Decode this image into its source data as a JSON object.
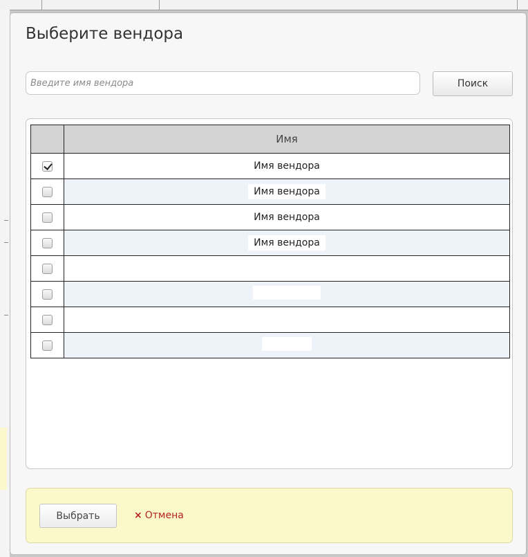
{
  "dialog": {
    "title": "Выберите вендора",
    "search": {
      "placeholder": "Введите имя вендора",
      "value": "",
      "button_label": "Поиск"
    },
    "table": {
      "header_name": "Имя",
      "rows": [
        {
          "checked": true,
          "name": "Имя вендора"
        },
        {
          "checked": false,
          "name": "Имя вендора"
        },
        {
          "checked": false,
          "name": "Имя вендора"
        },
        {
          "checked": false,
          "name": "Имя вендора"
        },
        {
          "checked": false,
          "name": ""
        },
        {
          "checked": false,
          "name": ""
        },
        {
          "checked": false,
          "name": ""
        },
        {
          "checked": false,
          "name": ""
        }
      ]
    },
    "footer": {
      "select_label": "Выбрать",
      "cancel_icon": "×",
      "cancel_label": "Отмена"
    }
  }
}
